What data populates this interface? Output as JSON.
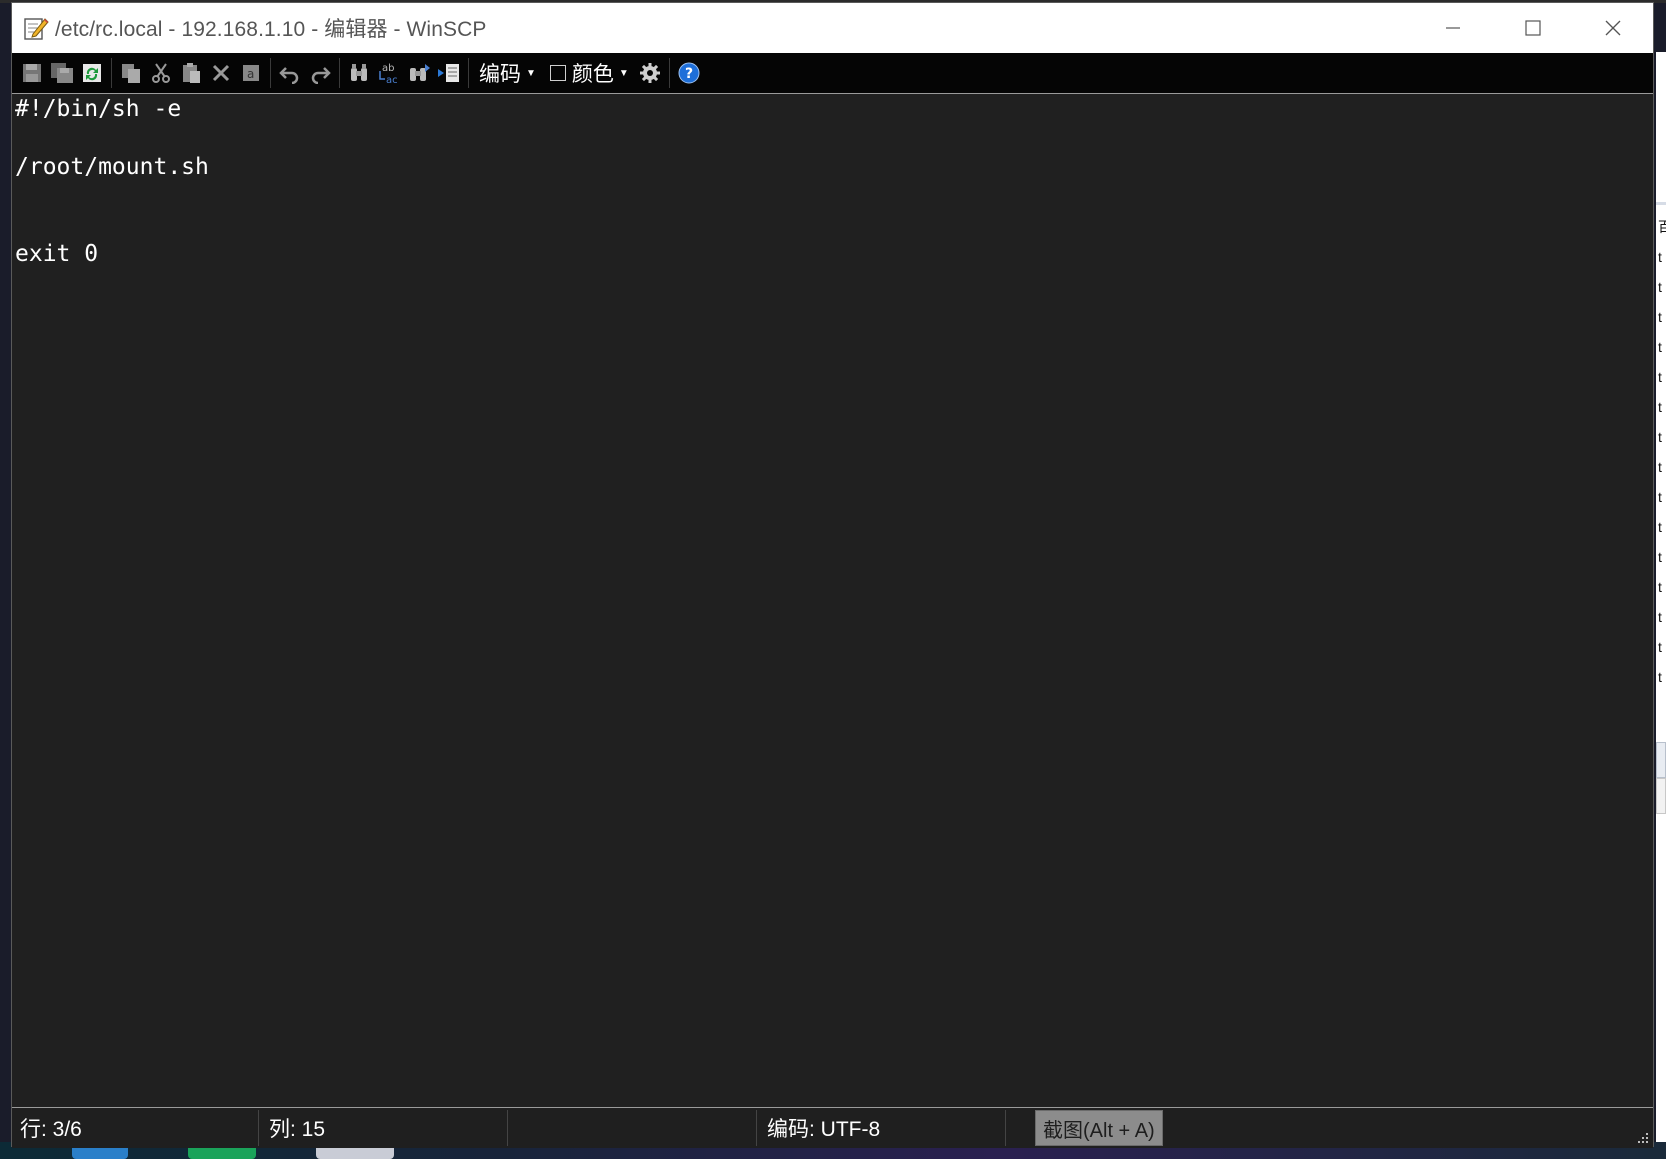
{
  "window": {
    "title": "/etc/rc.local - 192.168.1.10 - 编辑器 - WinSCP"
  },
  "toolbar": {
    "buttons": [
      {
        "name": "save-icon"
      },
      {
        "name": "save-all-icon"
      },
      {
        "name": "reload-icon"
      },
      {
        "name": "copy-icon"
      },
      {
        "name": "cut-icon"
      },
      {
        "name": "paste-icon"
      },
      {
        "name": "delete-icon"
      },
      {
        "name": "select-all-icon"
      },
      {
        "name": "undo-icon"
      },
      {
        "name": "redo-icon"
      },
      {
        "name": "find-icon"
      },
      {
        "name": "replace-icon"
      },
      {
        "name": "find-next-icon"
      },
      {
        "name": "goto-line-icon"
      }
    ],
    "encoding_label": "编码",
    "color_label": "颜色",
    "settings_icon": "gear-icon",
    "help_icon": "help-icon"
  },
  "editor": {
    "lines": [
      "#!/bin/sh -e",
      "",
      "/root/mount.sh",
      "",
      "",
      "exit 0"
    ]
  },
  "statusbar": {
    "line": "行: 3/6",
    "column": "列: 15",
    "empty": "",
    "encoding": "编码: UTF-8",
    "tooltip": "截图(Alt + A)"
  },
  "background_window": {
    "glyphs": [
      "百",
      "t",
      "t",
      "t",
      "t",
      "t",
      "t",
      "t",
      "t",
      "t",
      "t",
      "t",
      "t",
      "t",
      "t",
      "t"
    ]
  },
  "colors": {
    "editor_bg": "#202020",
    "toolbar_bg": "#050505",
    "text": "#ffffff",
    "help_blue": "#1e6fd9"
  }
}
